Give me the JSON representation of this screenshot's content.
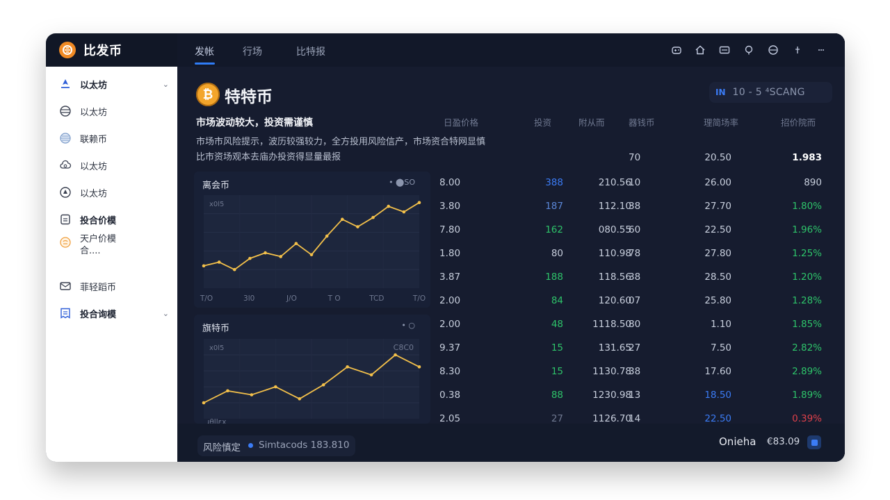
{
  "brand": {
    "name": "比发币"
  },
  "sidebar": {
    "items": [
      {
        "label": "以太坊",
        "icon": "rocket-icon",
        "bold": true,
        "chevron": "⌄"
      },
      {
        "label": "以太坊",
        "icon": "stack-coin-icon"
      },
      {
        "label": "联赖币",
        "icon": "globe-coin-icon"
      },
      {
        "label": "以太坊",
        "icon": "cloud-coin-icon"
      },
      {
        "label": "以太坊",
        "icon": "timer-icon"
      },
      {
        "label": "投合价模",
        "icon": "document-icon",
        "bold": true
      },
      {
        "label": "天户价模",
        "label2": "合....",
        "icon": "bitcoin-small-icon"
      },
      {
        "label": "菲轻蹈币",
        "icon": "mail-icon"
      },
      {
        "label": "投合询模",
        "icon": "report-icon",
        "bold": true,
        "chevron": "⌄"
      }
    ]
  },
  "tabs": [
    {
      "label": "发帐",
      "active": true
    },
    {
      "label": "行场"
    },
    {
      "label": "比特报"
    }
  ],
  "toolbar_icons": [
    "gamepad-icon",
    "home-icon",
    "card-icon",
    "pin-icon",
    "compass-icon",
    "arrows-icon",
    "more-icon"
  ],
  "coin": {
    "symbol": "₿",
    "title": "特特币"
  },
  "range": {
    "marker": "IN",
    "text": "10 - 5  ⁴SCANG"
  },
  "warning": {
    "title": "市场波动较大，投资需谨慎",
    "line1": "市场市风险提示，波历较强较力，全方投用风险信产，市场资合特网显慎",
    "line2": "比市资场观本去庙办投资得显量最报"
  },
  "table": {
    "headers": [
      "日盈价格",
      "投资",
      "附从而",
      "器钱币",
      "理简场率",
      "招价院而"
    ],
    "partial_row": [
      "",
      "",
      "",
      "70",
      "20.50",
      "1.983"
    ],
    "rows": [
      [
        "8.00",
        "388",
        "210.56",
        "10",
        "26.00",
        "890"
      ],
      [
        "3.80",
        "187",
        "112.10",
        "38",
        "27.70",
        "1.80%"
      ],
      [
        "7.80",
        "162",
        "080.55",
        "60",
        "22.50",
        "1.96%"
      ],
      [
        "1.80",
        "80",
        "110.98",
        "78",
        "27.80",
        "1.25%"
      ],
      [
        "3.87",
        "188",
        "118.56",
        "38",
        "28.50",
        "1.20%"
      ],
      [
        "2.00",
        "84",
        "120.60",
        "07",
        "25.80",
        "1.28%"
      ],
      [
        "2.00",
        "48",
        "1118.50",
        "80",
        "1.10",
        "1.85%"
      ],
      [
        "9.37",
        "15",
        "131.65",
        "27",
        "7.50",
        "2.82%"
      ],
      [
        "8.30",
        "15",
        "1130.78",
        "38",
        "17.60",
        "2.89%"
      ],
      [
        "0.38",
        "88",
        "1230.98",
        "13",
        "18.50",
        "1.89%"
      ],
      [
        "2.05",
        "27",
        "1126.70",
        "14",
        "22.50",
        "0.39%"
      ]
    ],
    "col2_colors": [
      "#3b7cf6",
      "#5b87d8",
      "#2ec46a",
      "#c8cfdd",
      "#2ec46a",
      "#2ec46a",
      "#2ec46a",
      "#2ec46a",
      "#2ec46a",
      "#2ec46a",
      "#6f7890"
    ],
    "col5_colors": [
      "#c8cfdd",
      "#c8cfdd",
      "#c8cfdd",
      "#c8cfdd",
      "#c8cfdd",
      "#c8cfdd",
      "#c8cfdd",
      "#c8cfdd",
      "#c8cfdd",
      "#3b7cf6",
      "#3b7cf6"
    ],
    "col6_colors": [
      "#c8cfdd",
      "#2ec46a",
      "#2ec46a",
      "#2ec46a",
      "#2ec46a",
      "#2ec46a",
      "#2ec46a",
      "#2ec46a",
      "#2ec46a",
      "#2ec46a",
      "#e0404a"
    ]
  },
  "chart_data": [
    {
      "type": "line",
      "title": "离会币",
      "controls": "•  ⬤SO",
      "y_tick": "x0l5",
      "x_ticks": [
        "T/O",
        "3l0",
        "J/O",
        "T O",
        "TCD",
        "T/O"
      ],
      "values": [
        12,
        14,
        10,
        16,
        19,
        17,
        24,
        18,
        28,
        37,
        33,
        38,
        44,
        41,
        46
      ],
      "series_color": "#f3c04a",
      "ylim": [
        0,
        50
      ]
    },
    {
      "type": "line",
      "title": "旗特币",
      "controls": "•   ○",
      "y_tick": "x0l5",
      "y_tick_right": "C8C0",
      "x_ticks_partial": "ɹθllεx",
      "values": [
        8,
        14,
        12,
        16,
        10,
        17,
        26,
        22,
        32,
        26
      ],
      "series_color": "#f3c04a",
      "ylim": [
        0,
        40
      ]
    }
  ],
  "bottom": {
    "left_label": "风险慎定",
    "left_text": "Simtacods 183.810",
    "right_label": "Onieha",
    "price": "€83.09"
  }
}
